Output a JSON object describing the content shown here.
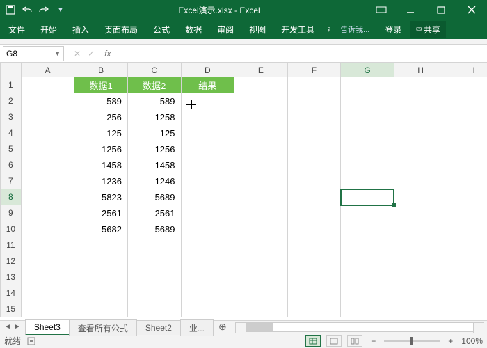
{
  "title": "Excel演示.xlsx - Excel",
  "ribbon": {
    "tabs": [
      "文件",
      "开始",
      "插入",
      "页面布局",
      "公式",
      "数据",
      "审阅",
      "视图",
      "开发工具"
    ],
    "tell": "告诉我...",
    "login": "登录",
    "share": "共享"
  },
  "namebox": "G8",
  "columns": [
    "A",
    "B",
    "C",
    "D",
    "E",
    "F",
    "G",
    "H",
    "I"
  ],
  "rows_visible": 15,
  "headers": {
    "b": "数据1",
    "c": "数据2",
    "d": "结果"
  },
  "data": [
    {
      "b": "589",
      "c": "589"
    },
    {
      "b": "256",
      "c": "1258"
    },
    {
      "b": "125",
      "c": "125"
    },
    {
      "b": "1256",
      "c": "1256"
    },
    {
      "b": "1458",
      "c": "1458"
    },
    {
      "b": "1236",
      "c": "1246"
    },
    {
      "b": "5823",
      "c": "5689"
    },
    {
      "b": "2561",
      "c": "2561"
    },
    {
      "b": "5682",
      "c": "5689"
    }
  ],
  "selected": {
    "row": 8,
    "col": "G"
  },
  "sheets": {
    "active": "Sheet3",
    "others": [
      "查看所有公式",
      "Sheet2",
      "业..."
    ]
  },
  "status": {
    "ready": "就绪",
    "zoom": "100%"
  }
}
